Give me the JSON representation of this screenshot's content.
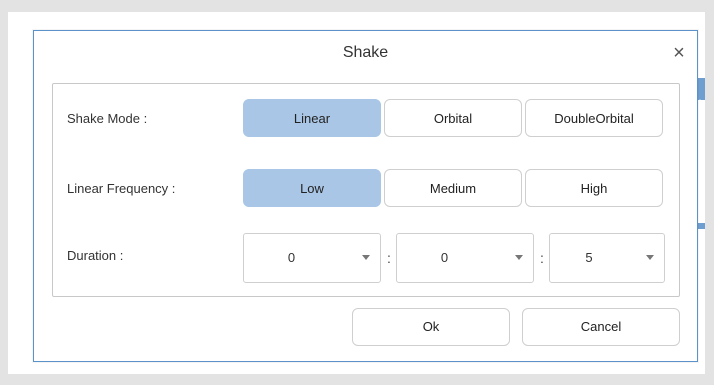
{
  "dialog": {
    "title": "Shake",
    "close_glyph": "×"
  },
  "shake_mode": {
    "label": "Shake Mode :",
    "options": [
      "Linear",
      "Orbital",
      "DoubleOrbital"
    ],
    "selected": "Linear"
  },
  "linear_frequency": {
    "label": "Linear Frequency :",
    "options": [
      "Low",
      "Medium",
      "High"
    ],
    "selected": "Low"
  },
  "duration": {
    "label": "Duration :",
    "separator": ":",
    "fields": [
      "0",
      "0",
      "5"
    ]
  },
  "footer": {
    "ok_label": "Ok",
    "cancel_label": "Cancel"
  },
  "colors": {
    "selected_bg": "#a9c6e6",
    "dialog_border": "#5a92c9",
    "background": "#e3e3e3"
  },
  "icons": {
    "close": "close-icon",
    "dropdown": "chevron-down-icon"
  }
}
